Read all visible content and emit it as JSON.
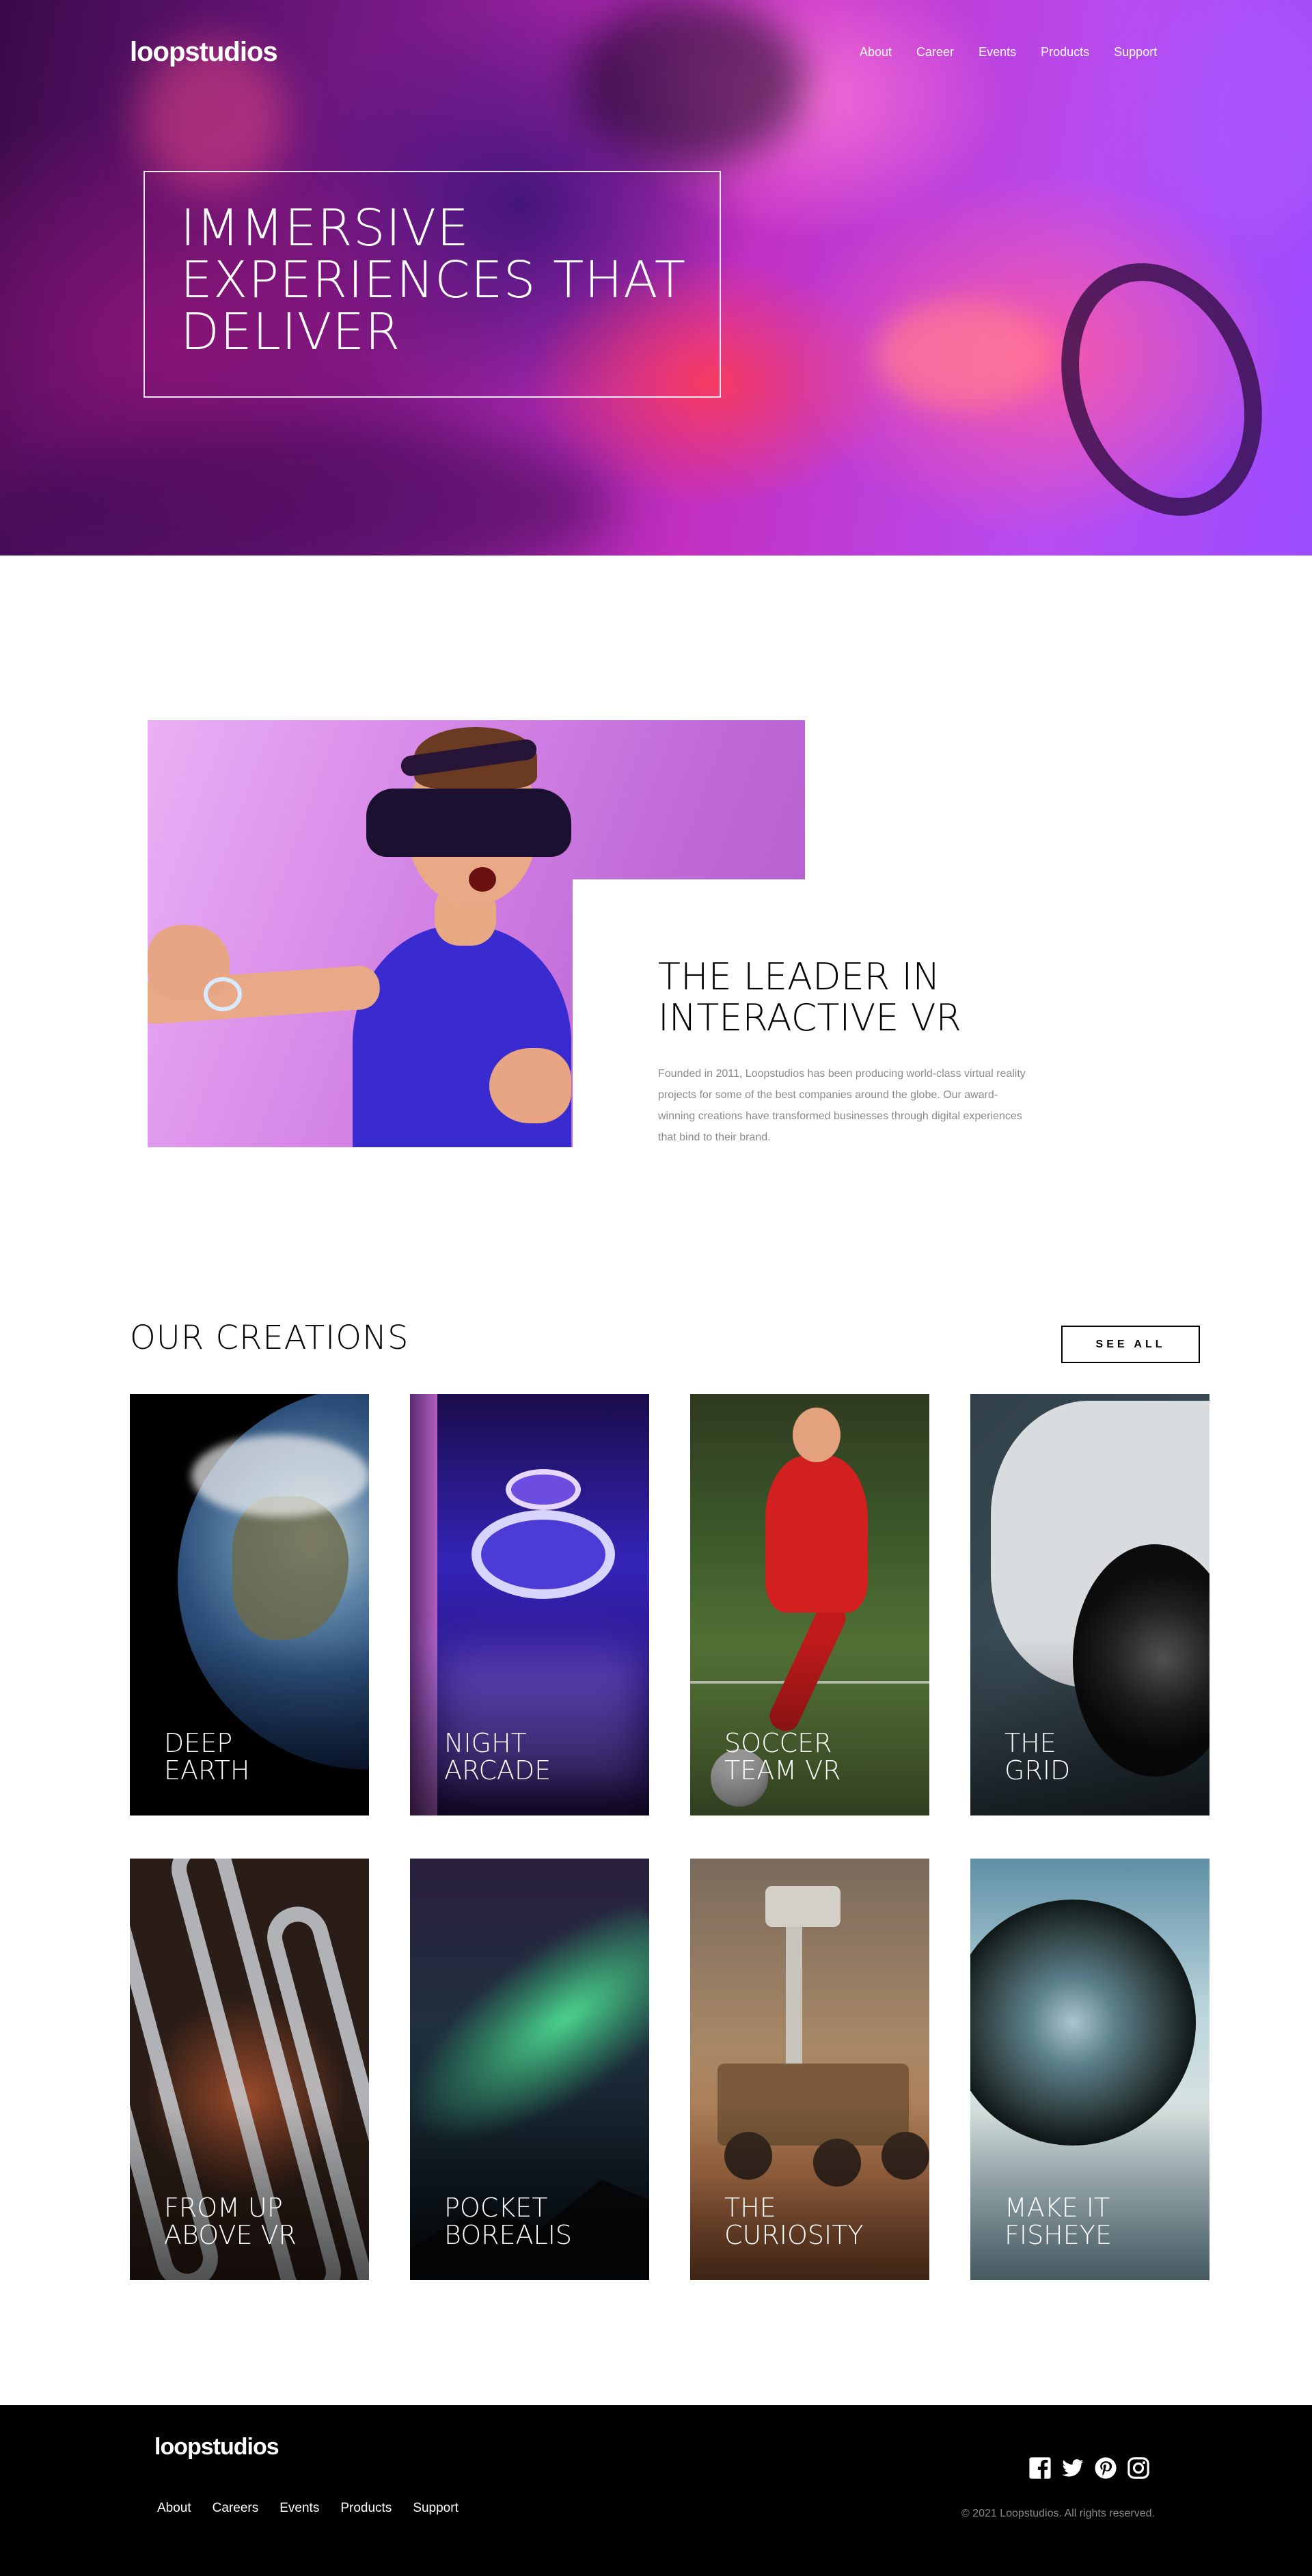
{
  "brand": {
    "logo": "loopstudios"
  },
  "nav": {
    "items": [
      "About",
      "Career",
      "Events",
      "Products",
      "Support"
    ]
  },
  "hero": {
    "title": "Immersive experiences that deliver"
  },
  "about": {
    "title": "The leader in interactive VR",
    "text": "Founded in 2011, Loopstudios has been producing world-class virtual reality projects for some of the best companies around the globe. Our award-winning creations have transformed businesses through digital experiences that bind to their brand."
  },
  "creations": {
    "title": "Our creations",
    "see_all_label": "See all",
    "cards": [
      {
        "line1": "Deep",
        "line2": "Earth"
      },
      {
        "line1": "Night",
        "line2": "Arcade"
      },
      {
        "line1": "Soccer",
        "line2": "Team VR"
      },
      {
        "line1": "The",
        "line2": "Grid"
      },
      {
        "line1": "From up",
        "line2": "above VR"
      },
      {
        "line1": "Pocket",
        "line2": "Borealis"
      },
      {
        "line1": "The",
        "line2": "Curiosity"
      },
      {
        "line1": "Make it",
        "line2": "Fisheye"
      }
    ]
  },
  "footer": {
    "logo": "loopstudios",
    "nav": [
      "About",
      "Careers",
      "Events",
      "Products",
      "Support"
    ],
    "copyright": "© 2021 Loopstudios. All rights reserved.",
    "socials": [
      "facebook-icon",
      "twitter-icon",
      "pinterest-icon",
      "instagram-icon"
    ]
  }
}
